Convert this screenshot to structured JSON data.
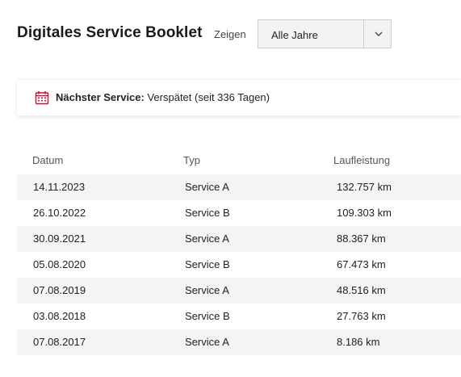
{
  "header": {
    "title": "Digitales Service Booklet",
    "show_label": "Zeigen",
    "filter_value": "Alle Jahre"
  },
  "notice": {
    "icon": "calendar-icon",
    "label": "Nächster Service:",
    "text": "Verspätet (seit 336 Tagen)",
    "icon_color": "#c8102e"
  },
  "table": {
    "columns": {
      "date": "Datum",
      "type": "Typ",
      "mileage": "Laufleistung"
    },
    "rows": [
      {
        "date": "14.11.2023",
        "type": "Service A",
        "mileage": "132.757 km"
      },
      {
        "date": "26.10.2022",
        "type": "Service B",
        "mileage": "109.303 km"
      },
      {
        "date": "30.09.2021",
        "type": "Service A",
        "mileage": "88.367 km"
      },
      {
        "date": "05.08.2020",
        "type": "Service B",
        "mileage": "67.473 km"
      },
      {
        "date": "07.08.2019",
        "type": "Service A",
        "mileage": "48.516 km"
      },
      {
        "date": "03.08.2018",
        "type": "Service B",
        "mileage": "27.763 km"
      },
      {
        "date": "07.08.2017",
        "type": "Service A",
        "mileage": "8.186 km"
      }
    ]
  }
}
